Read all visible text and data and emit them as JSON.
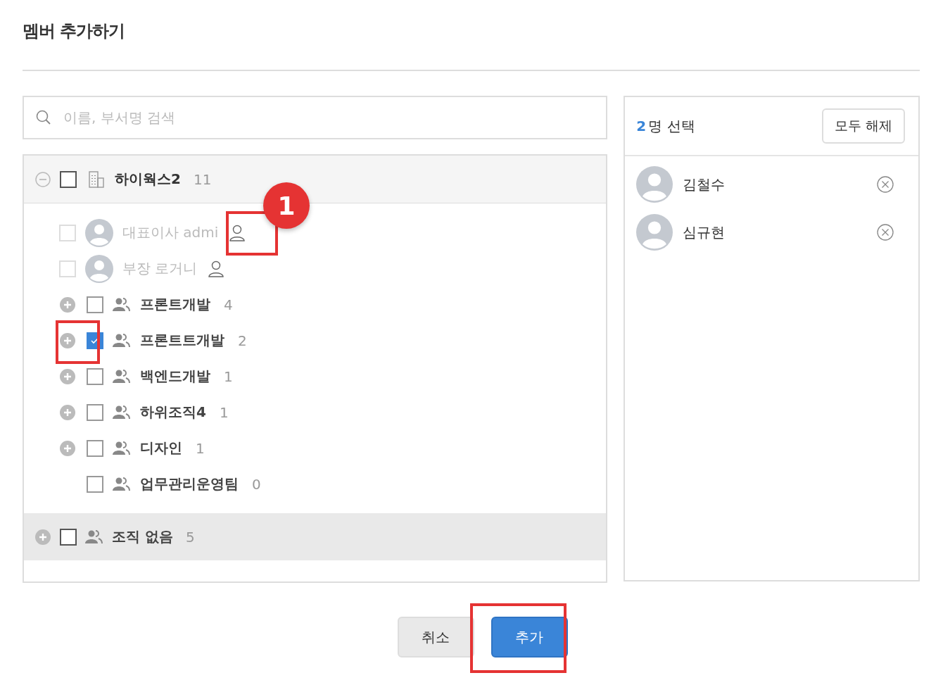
{
  "title": "멤버 추가하기",
  "search": {
    "placeholder": "이름, 부서명 검색"
  },
  "tree": {
    "root": {
      "name": "하이웍스2",
      "count": "11",
      "expanded": true,
      "checked": false
    },
    "children": [
      {
        "kind": "member",
        "name": "대표이사 admi",
        "disabled": true,
        "checked": false
      },
      {
        "kind": "member",
        "name": "부장 로거니",
        "disabled": true,
        "checked": false
      },
      {
        "kind": "department",
        "name": "프론트개발",
        "count": "4",
        "expandable": true,
        "checked": false
      },
      {
        "kind": "department",
        "name": "프론트트개발",
        "count": "2",
        "expandable": true,
        "checked": true
      },
      {
        "kind": "department",
        "name": "백엔드개발",
        "count": "1",
        "expandable": true,
        "checked": false
      },
      {
        "kind": "department",
        "name": "하위조직4",
        "count": "1",
        "expandable": true,
        "checked": false
      },
      {
        "kind": "department",
        "name": "디자인",
        "count": "1",
        "expandable": true,
        "checked": false
      },
      {
        "kind": "department",
        "name": "업무관리운영팀",
        "count": "0",
        "expandable": false,
        "checked": false
      }
    ],
    "groups": [
      {
        "name": "조직 없음",
        "count": "5",
        "expanded": false,
        "checked": false
      }
    ]
  },
  "selection": {
    "count": "2",
    "label": "명 선택",
    "clear_button": "모두 해제",
    "members": [
      {
        "name": "김철수"
      },
      {
        "name": "심규현"
      }
    ]
  },
  "buttons": {
    "cancel": "취소",
    "confirm": "추가"
  },
  "callout": {
    "label": "1"
  }
}
